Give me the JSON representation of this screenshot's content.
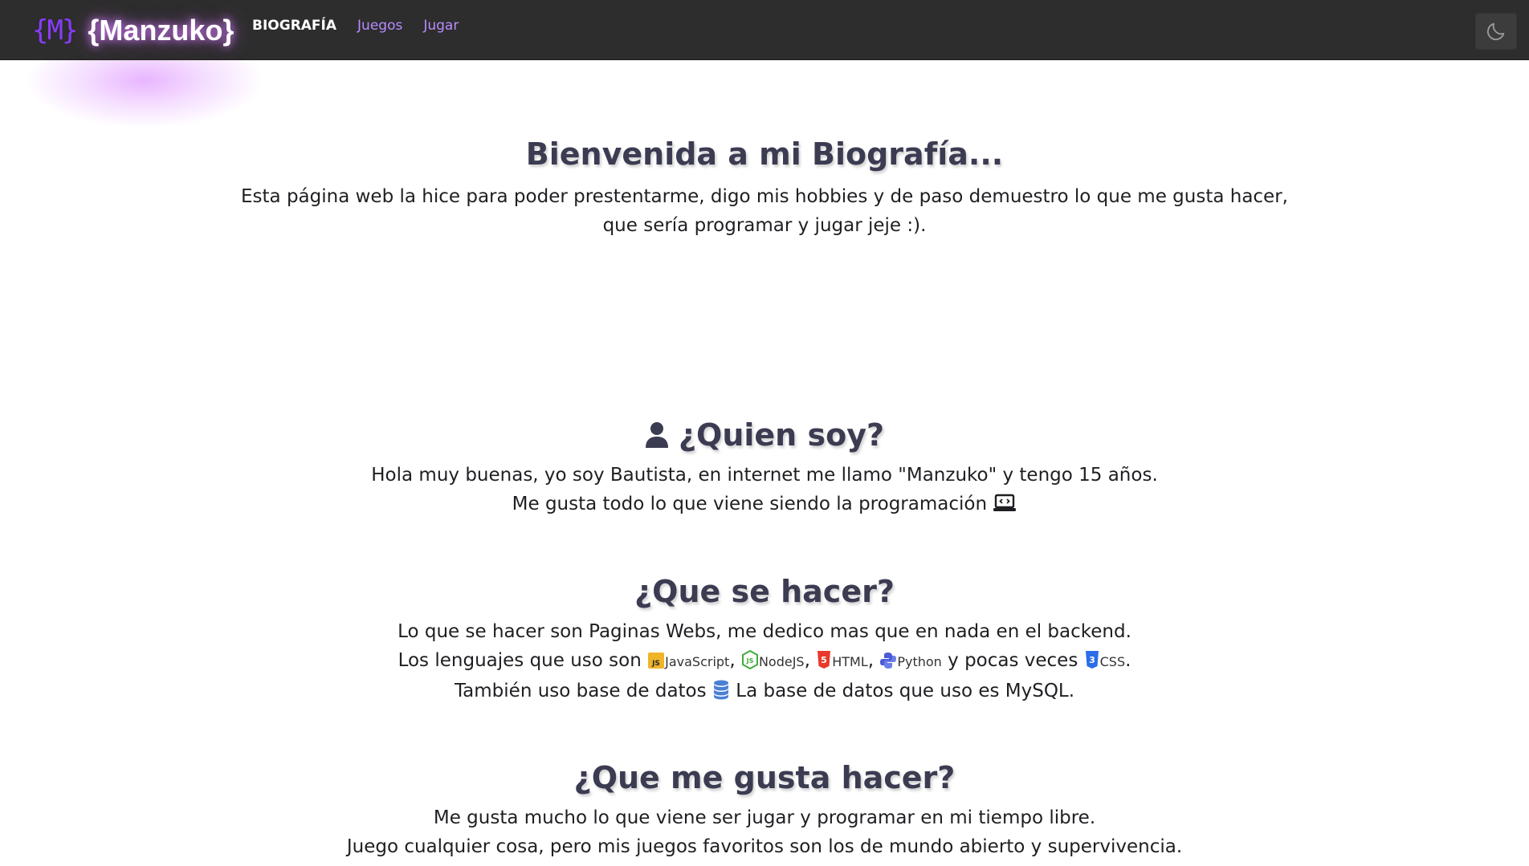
{
  "navbar": {
    "logo_mark": "{M}",
    "brand_name": "{Manzuko}",
    "links": [
      {
        "label": "BIOGRAFÍA",
        "active": true
      },
      {
        "label": "Juegos",
        "active": false
      },
      {
        "label": "Jugar",
        "active": false
      }
    ],
    "theme_toggle_icon": "moon-icon"
  },
  "intro": {
    "title": "Bienvenida a mi Biografía...",
    "line1": "Esta página web la hice para poder prestentarme, digo mis hobbies y de paso demuestro lo que me gusta hacer,",
    "line2": "que sería programar y jugar jeje :)."
  },
  "who": {
    "icon": "user-icon",
    "title": "¿Quien soy?",
    "line1": "Hola muy buenas, yo soy Bautista, en internet me llamo \"Manzuko\" y tengo 15 años.",
    "line2": "Me gusta todo lo que viene siendo la programación",
    "line2_icon": "laptop-code-icon"
  },
  "skills": {
    "title": "¿Que se hacer?",
    "line1": "Lo que se hacer son Paginas Webs, me dedico mas que en nada en el backend.",
    "line2_prefix": "Los lenguajes que uso son",
    "techs": [
      {
        "label": "JavaScript",
        "icon": "js-icon",
        "color": "#f0b429"
      },
      {
        "label": "NodeJS",
        "icon": "nodejs-icon",
        "color": "#3fae3a"
      },
      {
        "label": "HTML",
        "icon": "html5-icon",
        "color": "#e8392b"
      },
      {
        "label": "Python",
        "icon": "python-icon",
        "color": "#4a5bd8"
      }
    ],
    "line2_middle": "y pocas veces",
    "css": {
      "label": "CSS",
      "icon": "css3-icon",
      "color": "#2b6ce8"
    },
    "line3_prefix": "También uso base de datos",
    "line3_icon": "database-icon",
    "line3_suffix": "La base de datos que uso es MySQL."
  },
  "likes": {
    "title": "¿Que me gusta hacer?",
    "line1": "Me gusta mucho lo que viene ser jugar y programar en mi tiempo libre.",
    "line2": "Juego cualquier cosa, pero mis juegos favoritos son los de mundo abierto y supervivencia."
  },
  "colors": {
    "navbar_bg": "#2d2d2d",
    "accent_purple": "#8a3bff",
    "nav_link": "#b98cff",
    "heading": "#3b3b52"
  }
}
